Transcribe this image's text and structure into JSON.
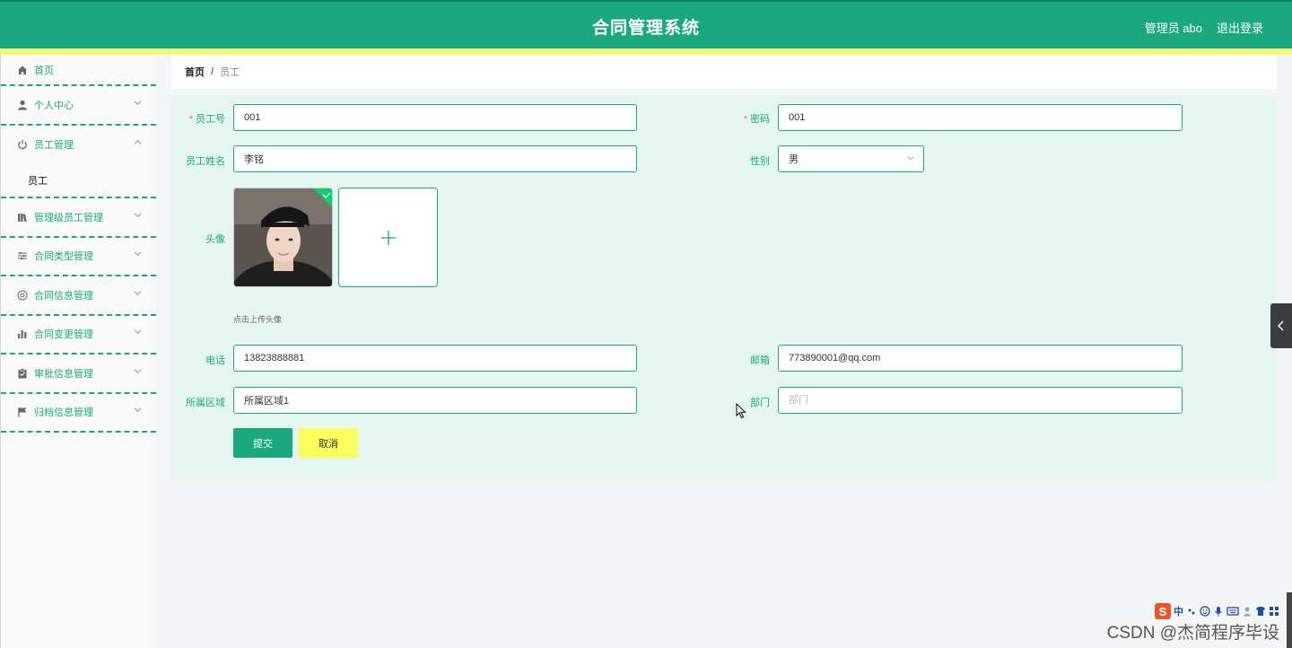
{
  "header": {
    "title": "合同管理系统",
    "user": "管理员 abo",
    "logout": "退出登录"
  },
  "sidebar": {
    "items": [
      {
        "label": "首页",
        "icon": "home-icon"
      },
      {
        "label": "个人中心",
        "icon": "user-icon"
      },
      {
        "label": "员工管理",
        "icon": "power-icon",
        "expanded": true,
        "children": [
          {
            "label": "员工"
          }
        ]
      },
      {
        "label": "管理级员工管理",
        "icon": "books-icon"
      },
      {
        "label": "合同类型管理",
        "icon": "sliders-icon"
      },
      {
        "label": "合同信息管理",
        "icon": "at-icon"
      },
      {
        "label": "合同变更管理",
        "icon": "bar-chart-icon"
      },
      {
        "label": "审批信息管理",
        "icon": "clipboard-icon"
      },
      {
        "label": "归档信息管理",
        "icon": "flag-icon"
      }
    ]
  },
  "breadcrumb": {
    "home": "首页",
    "separator": "/",
    "current": "员工"
  },
  "form": {
    "employee_no": {
      "label": "员工号",
      "value": "001",
      "required": true
    },
    "password": {
      "label": "密码",
      "value": "001",
      "required": true
    },
    "name": {
      "label": "员工姓名",
      "value": "李铭"
    },
    "gender": {
      "label": "性别",
      "value": "男"
    },
    "avatar": {
      "label": "头像",
      "hint": "点击上传头像",
      "upload_icon": "+"
    },
    "phone": {
      "label": "电话",
      "value": "13823888881"
    },
    "email": {
      "label": "邮箱",
      "value": "773890001@qq.com"
    },
    "region": {
      "label": "所属区域",
      "value": "所属区域1"
    },
    "department": {
      "label": "部门",
      "value": "",
      "placeholder": "部门"
    },
    "submit_label": "提交",
    "cancel_label": "取消"
  },
  "ime_toolbar": {
    "logo": "S",
    "mode": "中"
  },
  "watermark": "CSDN @杰简程序毕设",
  "colors": {
    "primary": "#1aa97e",
    "accent_yellow": "#fafd5c",
    "panel_bg": "#e5f6f0"
  }
}
